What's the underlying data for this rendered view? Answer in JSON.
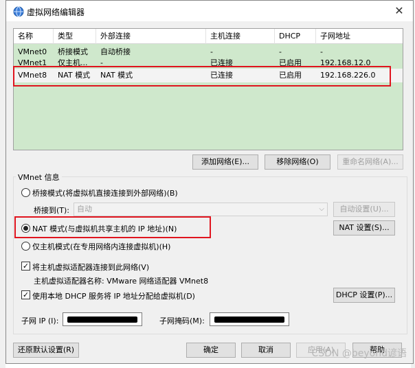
{
  "window": {
    "title": "虚拟网络编辑器",
    "close": "✕"
  },
  "table": {
    "columns": [
      "名称",
      "类型",
      "外部连接",
      "主机连接",
      "DHCP",
      "子网地址"
    ],
    "rows": [
      [
        "VMnet0",
        "桥接模式",
        "自动桥接",
        "-",
        "-",
        "-"
      ],
      [
        "VMnet1",
        "仅主机...",
        "-",
        "已连接",
        "已启用",
        "192.168.12.0"
      ],
      [
        "VMnet8",
        "NAT 模式",
        "NAT 模式",
        "已连接",
        "已启用",
        "192.168.226.0"
      ]
    ],
    "selected_row": 2
  },
  "table_buttons": {
    "add": "添加网络(E)...",
    "remove": "移除网络(O)",
    "rename": "重命名网络(A)..."
  },
  "vmnet_info": {
    "legend": "VMnet 信息",
    "bridged_label": "桥接模式(将虚拟机直接连接到外部网络)(B)",
    "bridged_to_label": "桥接到(T):",
    "bridged_to_value": "自动",
    "auto_settings": "自动设置(U)...",
    "nat_label": "NAT 模式(与虚拟机共享主机的 IP 地址)(N)",
    "nat_settings": "NAT 设置(S)...",
    "hostonly_label": "仅主机模式(在专用网络内连接虚拟机)(H)",
    "selected_mode": "nat",
    "connect_adapter_label": "将主机虚拟适配器连接到此网络(V)",
    "connect_adapter_checked": true,
    "adapter_name_label": "主机虚拟适配器名称: VMware 网络适配器 VMnet8",
    "dhcp_label": "使用本地 DHCP 服务将 IP 地址分配给虚拟机(D)",
    "dhcp_checked": true,
    "dhcp_settings": "DHCP 设置(P)...",
    "subnet_ip_label": "子网 IP (I):",
    "subnet_mask_label": "子网掩码(M):"
  },
  "footer": {
    "restore": "还原默认设置(R)",
    "ok": "确定",
    "cancel": "取消",
    "apply": "应用(A)",
    "help": "帮助"
  },
  "watermark": "CSDN @beyond谚语",
  "colors": {
    "table_bg": "#cfe8cc",
    "highlight": "#e0141e"
  },
  "check_glyph": "✓"
}
